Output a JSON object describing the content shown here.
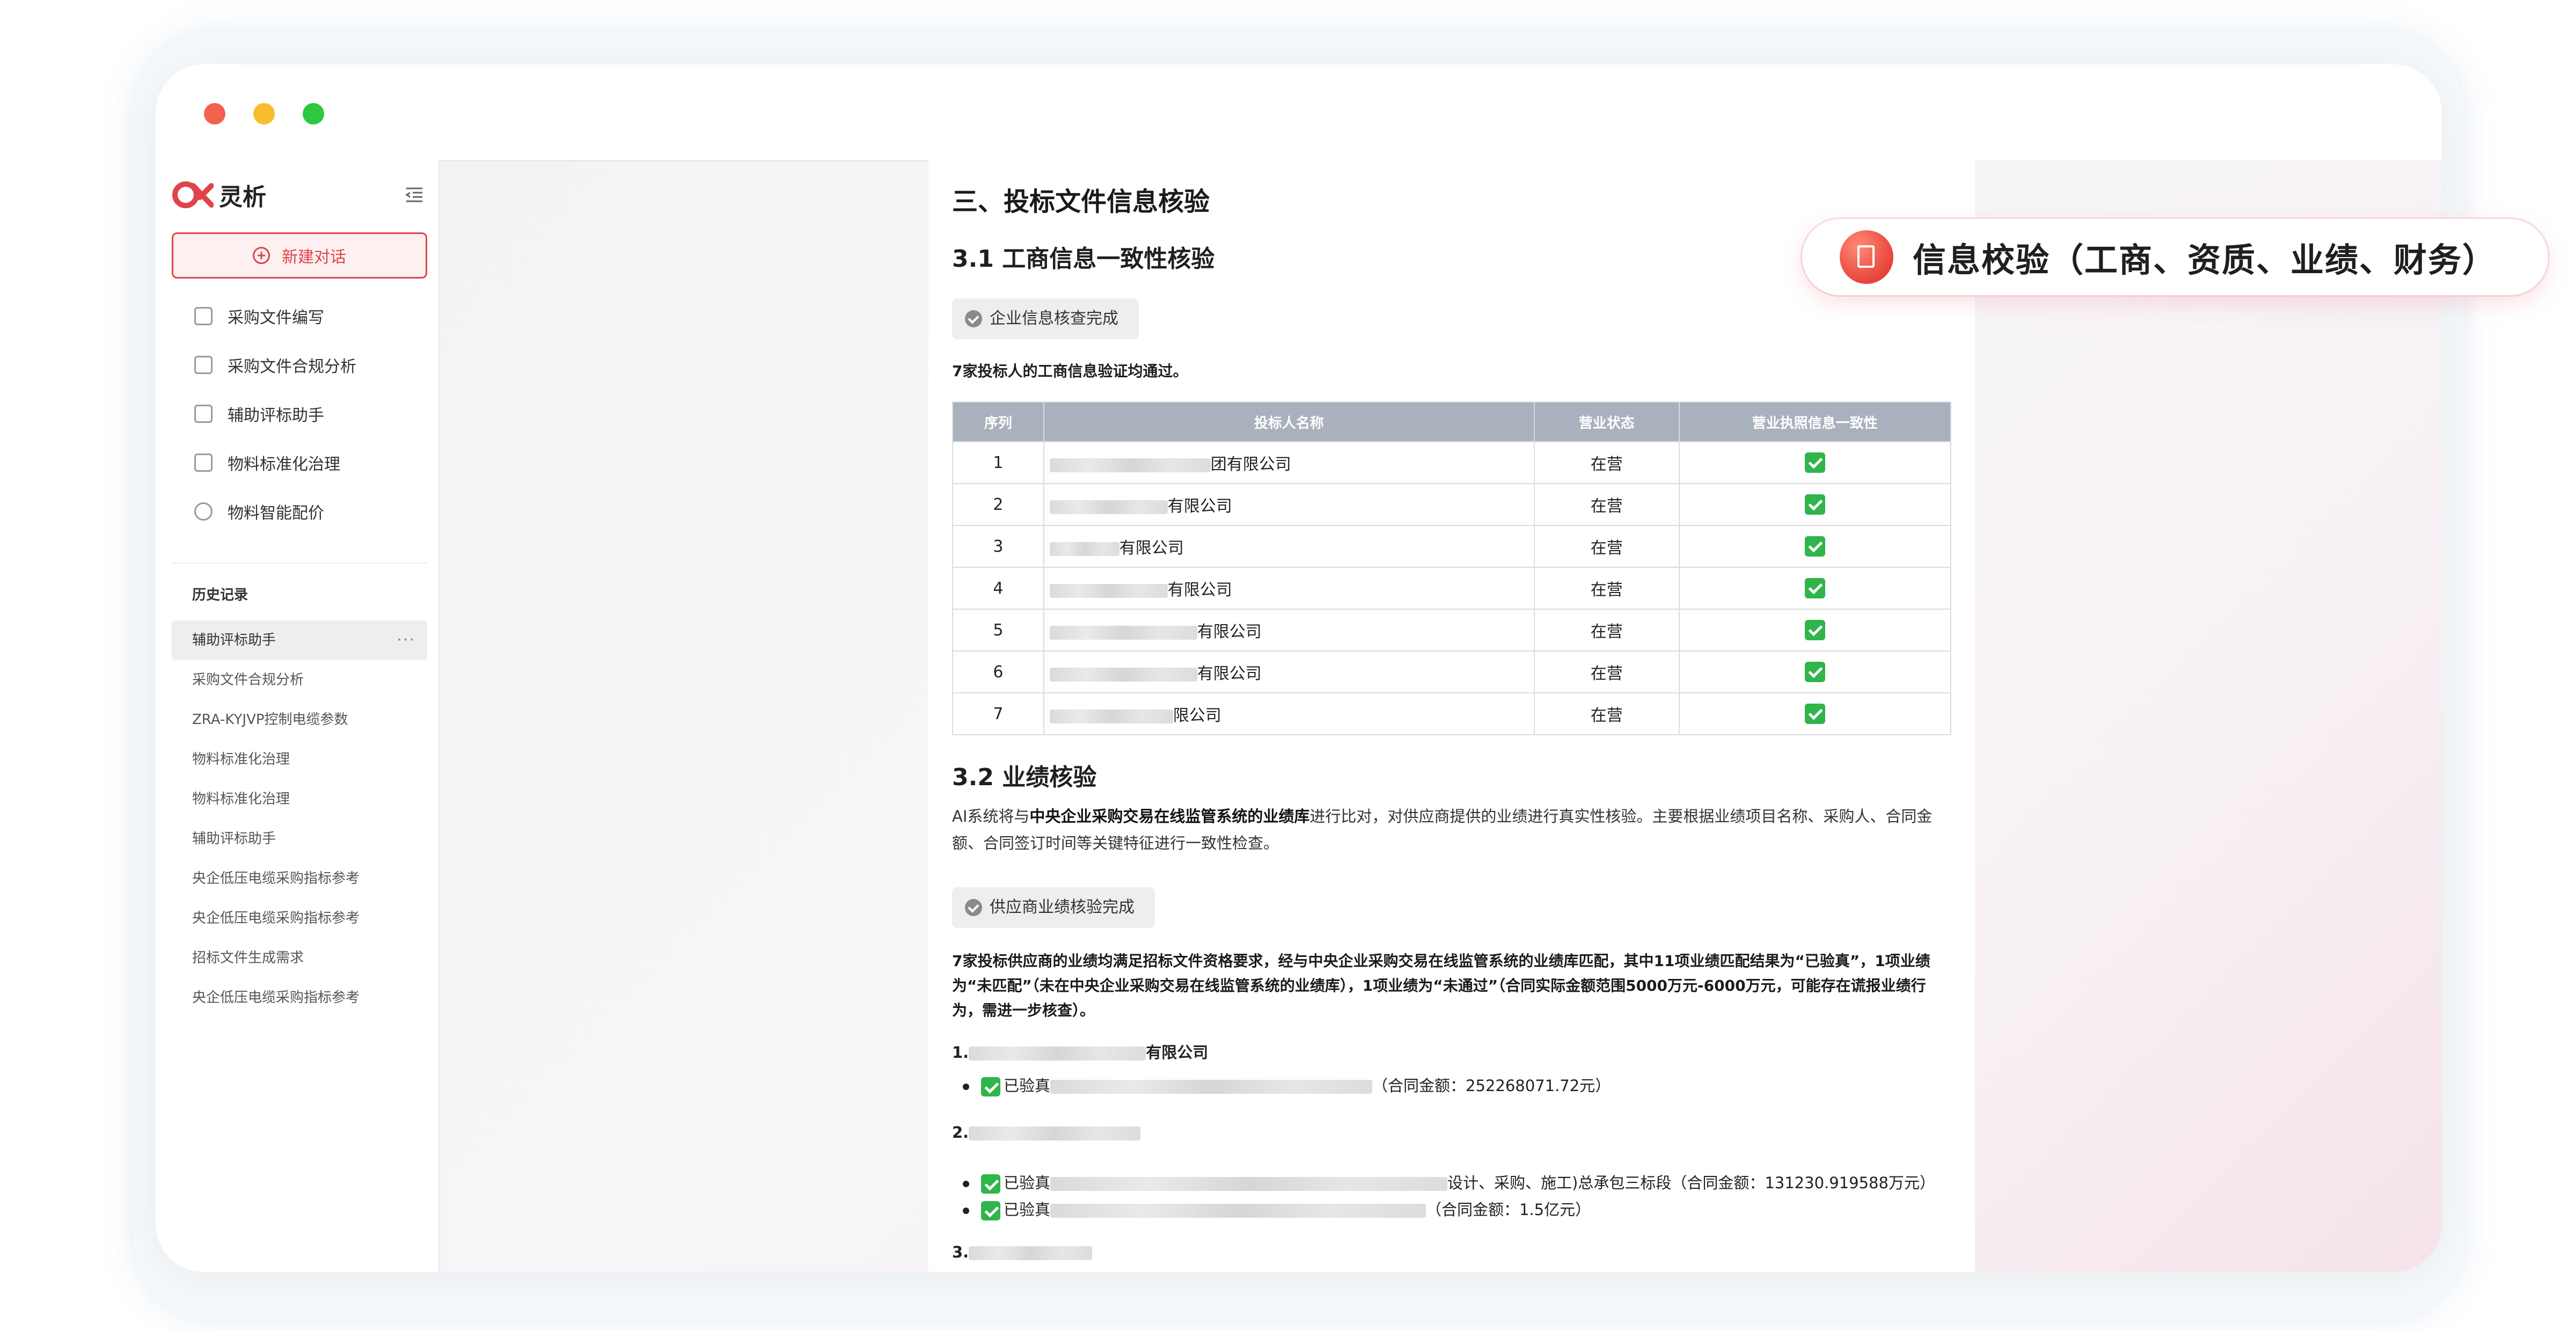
{
  "window": {
    "controls": [
      "close",
      "minimize",
      "maximize"
    ]
  },
  "sidebar": {
    "logo_text": "灵析",
    "new_chat_label": "新建对话",
    "menu": [
      {
        "label": "采购文件编写",
        "icon": "document-edit-icon"
      },
      {
        "label": "采购文件合规分析",
        "icon": "document-check-icon"
      },
      {
        "label": "辅助评标助手",
        "icon": "tag-icon"
      },
      {
        "label": "物料标准化治理",
        "icon": "list-sort-icon"
      },
      {
        "label": "物料智能配价",
        "icon": "lightbulb-icon"
      }
    ],
    "history_title": "历史记录",
    "history": [
      "辅助评标助手",
      "采购文件合规分析",
      "ZRA-KYJVP控制电缆参数",
      "物料标准化治理",
      "物料标准化治理",
      "辅助评标助手",
      "央企低压电缆采购指标参考",
      "央企低压电缆采购指标参考",
      "招标文件生成需求",
      "央企低压电缆采购指标参考"
    ],
    "history_more": "···"
  },
  "doc": {
    "section_title": "三、投标文件信息核验",
    "sub1_title": "3.1 工商信息一致性核验",
    "pill1": "企业信息核查完成",
    "summary1": "7家投标人的工商信息验证均通过。",
    "table": {
      "headers": [
        "序列",
        "投标人名称",
        "营业状态",
        "营业执照信息一致性"
      ],
      "rows": [
        {
          "seq": "1",
          "name_suffix": "团有限公司",
          "status": "在营"
        },
        {
          "seq": "2",
          "name_suffix": "有限公司",
          "status": "在营"
        },
        {
          "seq": "3",
          "name_suffix": "有限公司",
          "status": "在营"
        },
        {
          "seq": "4",
          "name_suffix": "有限公司",
          "status": "在营"
        },
        {
          "seq": "5",
          "name_suffix": "有限公司",
          "status": "在营"
        },
        {
          "seq": "6",
          "name_suffix": "有限公司",
          "status": "在营"
        },
        {
          "seq": "7",
          "name_suffix": "限公司",
          "status": "在营"
        }
      ]
    },
    "sub2_title": "3.2 业绩核验",
    "para_a": "AI系统将与",
    "para_bold": "中央企业采购交易在线监管系统的业绩库",
    "para_b": "进行比对，对供应商提供的业绩进行真实性核验。主要根据业绩项目名称、采购人、合同金额、合同签订时间等关键特征进行一致性检查。",
    "pill2": "供应商业绩核验完成",
    "summary2": "7家投标供应商的业绩均满足招标文件资格要求，经与中央企业采购交易在线监管系统的业绩库匹配，其中11项业绩匹配结果为“已验真”，1项业绩为“未匹配”（未在中央企业采购交易在线监管系统的业绩库），1项业绩为“未通过”（合同实际金额范围5000万元-6000万元，可能存在谎报业绩行为，需进一步核查）。",
    "perf": [
      {
        "title_prefix": "1.",
        "title_suffix": "有限公司",
        "lines": [
          {
            "prefix": "已验真",
            "suffix": "（合同金额：252268071.72元）"
          }
        ]
      },
      {
        "title_prefix": "2.",
        "title_suffix": "",
        "lines": [
          {
            "prefix": "已验真",
            "suffix": "设计、采购、施工)总承包三标段（合同金额：131230.919588万元）"
          },
          {
            "prefix": "已验真",
            "suffix": "（合同金额：1.5亿元）"
          }
        ]
      },
      {
        "title_prefix": "3.",
        "title_suffix": "",
        "lines": []
      }
    ]
  },
  "badge": {
    "text": "信息校验（工商、资质、业绩、财务）"
  },
  "colors": {
    "accent": "#e0434a",
    "table_header": "#a9b1bc",
    "check_green": "#2fb54a"
  }
}
